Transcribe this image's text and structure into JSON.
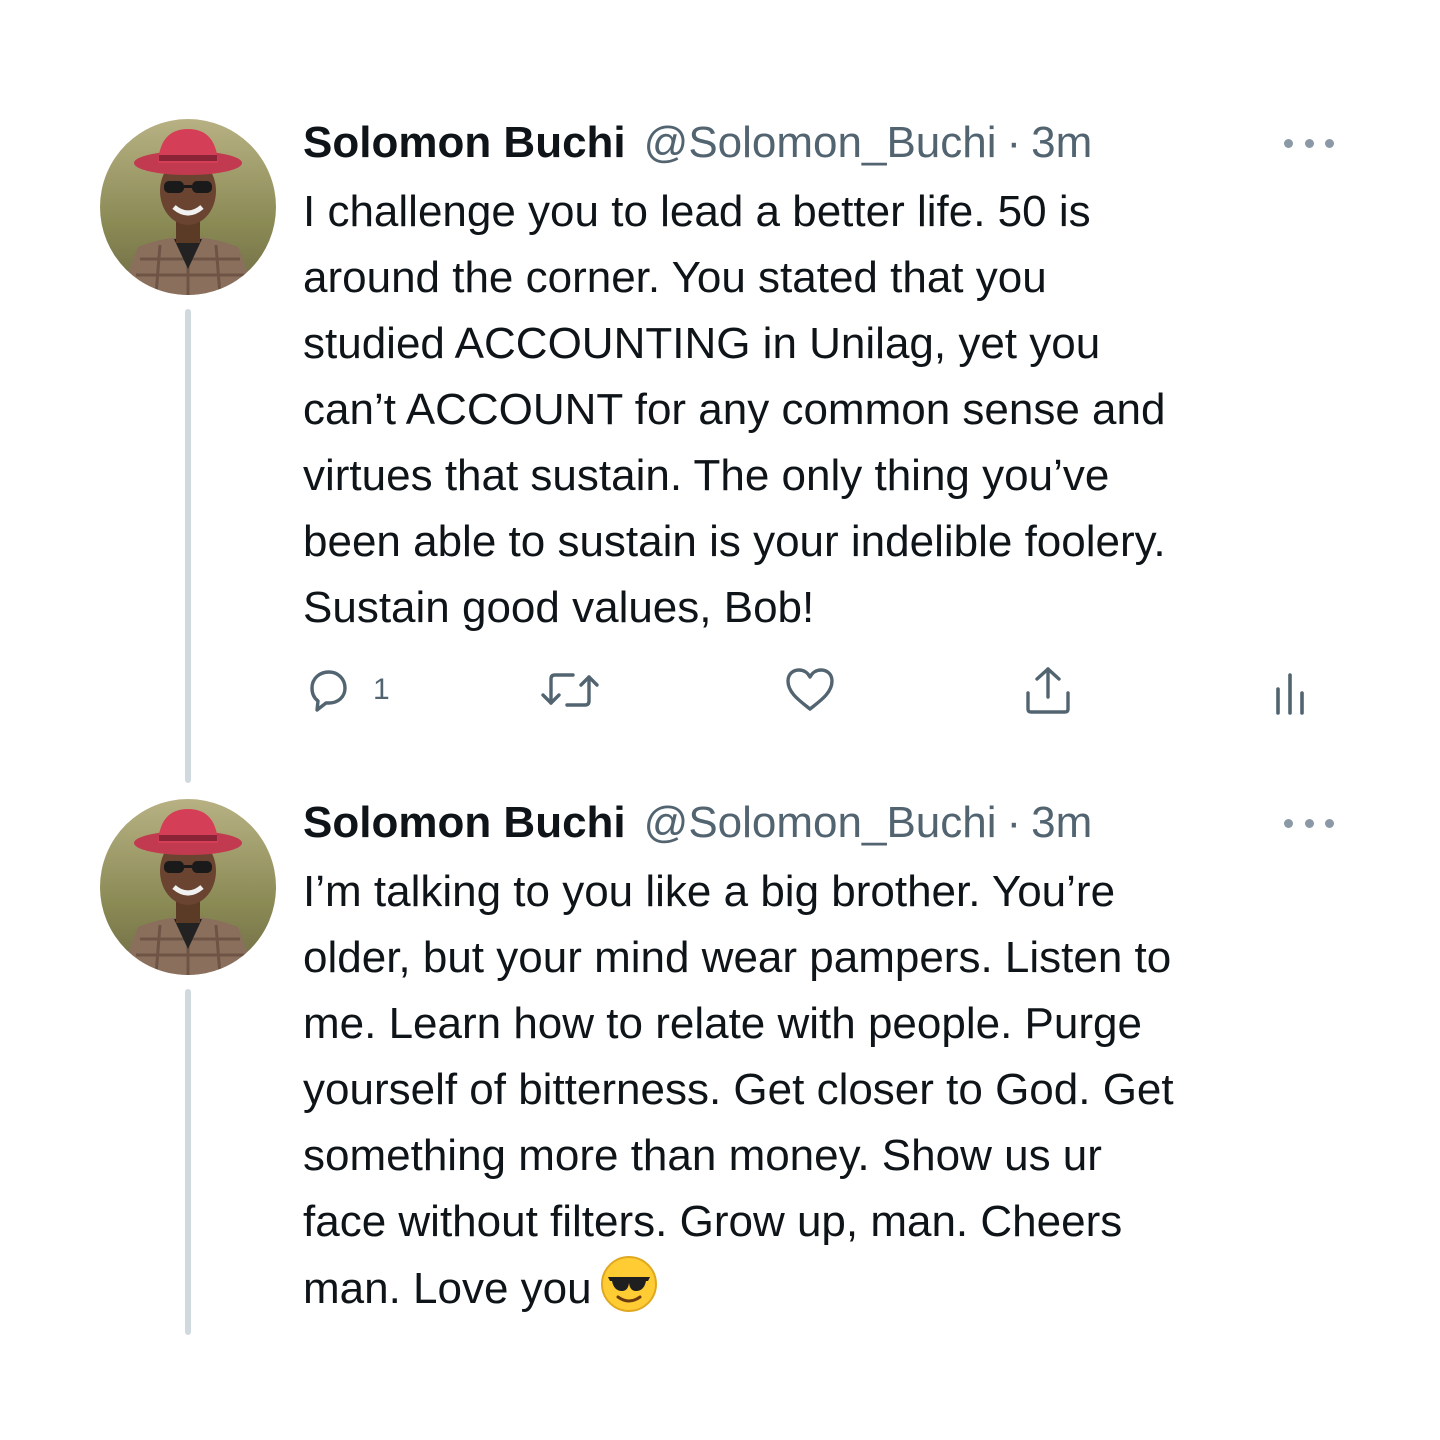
{
  "tweets": [
    {
      "name": "Solomon Buchi",
      "handle": "@Solomon_Buchi",
      "separator": "·",
      "time": "3m",
      "text": "I challenge you to lead a better life. 50 is\naround the corner. You stated that you\nstudied ACCOUNTING in Unilag, yet you\ncan’t ACCOUNT for any common sense and\nvirtues that sustain. The only thing you’ve\nbeen able to sustain is your indelible foolery.\nSustain good values, Bob!",
      "reply_count": "1",
      "icons": {
        "reply": "reply-icon",
        "retweet": "retweet-icon",
        "like": "like-icon",
        "share": "share-icon",
        "analytics": "analytics-icon",
        "more": "more-options-icon"
      }
    },
    {
      "name": "Solomon Buchi",
      "handle": "@Solomon_Buchi",
      "separator": "·",
      "time": "3m",
      "text": "I’m talking to you like a big brother. You’re\nolder, but your mind wear pampers. Listen to\nme. Learn how to relate with people. Purge\nyourself of bitterness. Get closer to God. Get\nsomething more than money. Show us ur\nface without filters. Grow up, man. Cheers\nman. Love you",
      "emoji": "smiling-face-with-sunglasses"
    }
  ],
  "colors": {
    "text": "#0f1419",
    "secondary": "#536471",
    "thread_line": "#cfd9de",
    "background": "#ffffff"
  }
}
